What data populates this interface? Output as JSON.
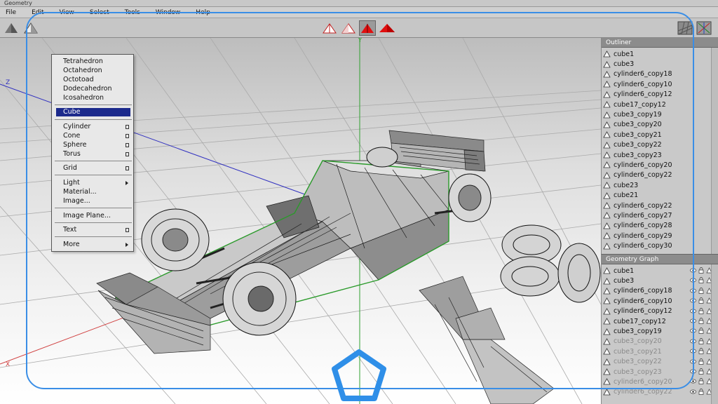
{
  "window": {
    "title": "Geometry"
  },
  "menubar": [
    "File",
    "Edit",
    "View",
    "Select",
    "Tools",
    "Window",
    "Help"
  ],
  "viewport": {
    "axis_y": "Y",
    "axis_z": "Z",
    "axis_x": "X"
  },
  "create_menu": {
    "items": [
      {
        "label": "Tetrahedron"
      },
      {
        "label": "Octahedron"
      },
      {
        "label": "Octotoad"
      },
      {
        "label": "Dodecahedron"
      },
      {
        "label": "Icosahedron"
      },
      {
        "label": "Cube",
        "highlighted": true
      },
      {
        "label": "Cylinder",
        "option": true
      },
      {
        "label": "Cone",
        "option": true
      },
      {
        "label": "Sphere",
        "option": true
      },
      {
        "label": "Torus",
        "option": true
      },
      {
        "label": "Grid",
        "option": true
      },
      {
        "label": "Light",
        "submenu": true
      },
      {
        "label": "Material..."
      },
      {
        "label": "Image..."
      },
      {
        "label": "Image Plane..."
      },
      {
        "label": "Text",
        "option": true
      },
      {
        "label": "More",
        "submenu": true
      }
    ]
  },
  "outliner": {
    "title": "Outliner",
    "items": [
      "cube1",
      "cube3",
      "cylinder6_copy18",
      "cylinder6_copy10",
      "cylinder6_copy12",
      "cube17_copy12",
      "cube3_copy19",
      "cube3_copy20",
      "cube3_copy21",
      "cube3_copy22",
      "cube3_copy23",
      "cylinder6_copy20",
      "cylinder6_copy22",
      "cube23",
      "cube21",
      "cylinder6_copy22",
      "cylinder6_copy27",
      "cylinder6_copy28",
      "cylinder6_copy29",
      "cylinder6_copy30"
    ]
  },
  "geometry_graph": {
    "title": "Geometry Graph",
    "items": [
      "cube1",
      "cube3",
      "cylinder6_copy18",
      "cylinder6_copy10",
      "cylinder6_copy12",
      "cube17_copy12",
      "cube3_copy19",
      "cube3_copy20",
      "cube3_copy21",
      "cube3_copy22",
      "cube3_copy23",
      "cylinder6_copy20",
      "cylinder6_copy22"
    ]
  },
  "colors": {
    "accent_overlay": "#3a8ee6",
    "menu_highlight": "#1c2a8c",
    "selection_wire": "#2a9a2a",
    "axis_x": "#d04040",
    "axis_y": "#30a030",
    "axis_z": "#3030c0"
  }
}
